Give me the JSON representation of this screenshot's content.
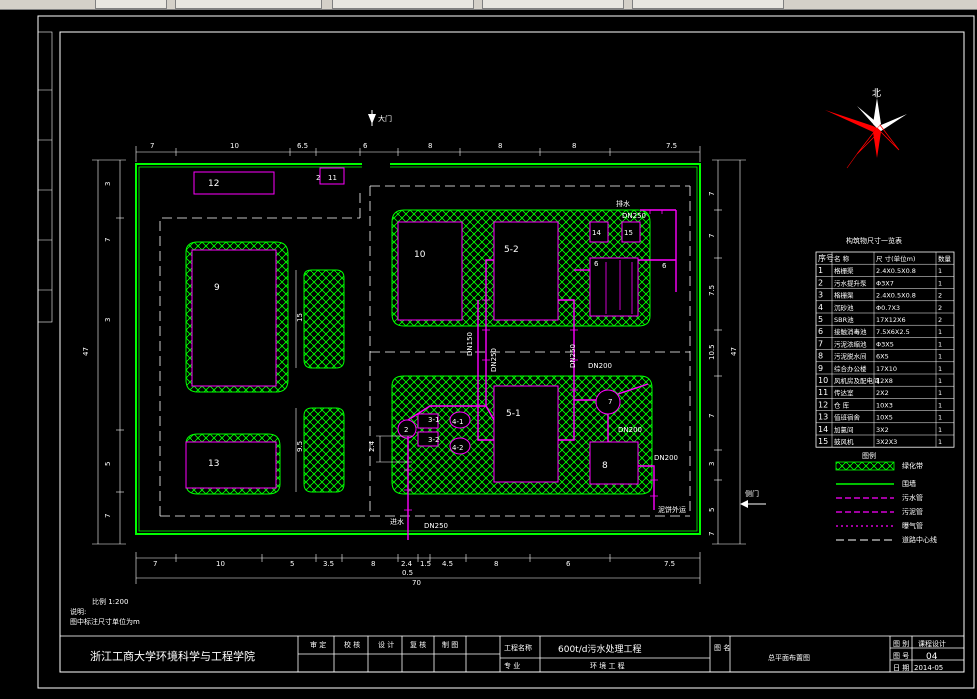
{
  "compass_label": "北",
  "gate_main": "大门",
  "gate_side": "侧门",
  "top_dims": [
    "7",
    "10",
    "6.5",
    "6",
    "8",
    "8",
    "8",
    "7.5"
  ],
  "bottom_dims": [
    "7",
    "10",
    "5",
    "3.5",
    "8",
    "2.4",
    "1.5",
    "4.5",
    "8",
    "6",
    "7.5"
  ],
  "bottom_small": "0.5",
  "total_width": "70",
  "left_dims": [
    "7",
    "3",
    "47",
    "5",
    "3",
    "7"
  ],
  "right_dims": [
    "7",
    "7",
    "6",
    "7.5",
    "10.5",
    "7",
    "47",
    "3",
    "5",
    "7"
  ],
  "inner_dims": [
    "15",
    "9.5",
    "2.4",
    "2"
  ],
  "buildings": {
    "b12": "12",
    "b11": "11",
    "b9": "9",
    "b13": "13",
    "b10": "10",
    "b52": "5-2",
    "b14": "14",
    "b15": "15",
    "b6": "6",
    "b51": "5-1",
    "b7": "7",
    "b8": "8",
    "b2": "2",
    "b31": "3-1",
    "b32": "3-2",
    "b41": "4-1",
    "b42": "4-2"
  },
  "pipes": {
    "dn250_top": "DN250",
    "dn150": "DN150",
    "dn250_mid": "DN250",
    "dn250_v2": "DN250",
    "dn200_a": "DN200",
    "dn200_b": "DN200",
    "dn200_c": "DN200",
    "dn250_bot": "DN250",
    "inlet": "进水",
    "outlet": "排水",
    "sludge_out": "泥饼外运"
  },
  "table": {
    "title": "构筑物尺寸一览表",
    "headers": [
      "序号",
      "名 称",
      "尺 寸(单位m)",
      "数量"
    ],
    "rows": [
      [
        "1",
        "格栅渠",
        "2.4X0.5X0.8",
        "1"
      ],
      [
        "2",
        "污水提升泵",
        "Φ3X7",
        "1"
      ],
      [
        "3",
        "格栅渠",
        "2.4X0.5X0.8",
        "2"
      ],
      [
        "4",
        "沉砂池",
        "Φ0.7X3",
        "2"
      ],
      [
        "5",
        "SBR池",
        "17X12X6",
        "2"
      ],
      [
        "6",
        "接触消毒池",
        "7.5X6X2.5",
        "1"
      ],
      [
        "7",
        "污泥浓缩池",
        "Φ3X5",
        "1"
      ],
      [
        "8",
        "污泥脱水间",
        "6X5",
        "1"
      ],
      [
        "9",
        "综合办公楼",
        "17X10",
        "1"
      ],
      [
        "10",
        "风机房及配电间",
        "12X8",
        "1"
      ],
      [
        "11",
        "传达室",
        "2X2",
        "1"
      ],
      [
        "12",
        "仓 库",
        "10X3",
        "1"
      ],
      [
        "13",
        "值班宿舍",
        "10X5",
        "1"
      ],
      [
        "14",
        "加氯间",
        "3X2",
        "1"
      ],
      [
        "15",
        "鼓风机",
        "3X2X3",
        "1"
      ]
    ]
  },
  "legend": {
    "title": "图例",
    "items": [
      "绿化带",
      "围墙",
      "污水管",
      "污泥管",
      "曝气管",
      "道路中心线"
    ]
  },
  "notes": [
    "比例 1:200",
    "说明:",
    "图中标注尺寸单位为m"
  ],
  "title_block": {
    "school": "浙江工商大学环境科学与工程学院",
    "cells": [
      "审 定",
      "校 核",
      "设 计",
      "复 核",
      "制 图"
    ],
    "project_label": "工程名称",
    "project_name": "600t/d污水处理工程",
    "major_label": "专 业",
    "major_value": "环 境 工 程",
    "drawing_label": "图 名",
    "drawing_name": "总平面布置图",
    "right_labels": [
      "图 别",
      "图 号",
      "日 期"
    ],
    "right_values": [
      "课程设计",
      "04",
      "2014-05"
    ]
  }
}
